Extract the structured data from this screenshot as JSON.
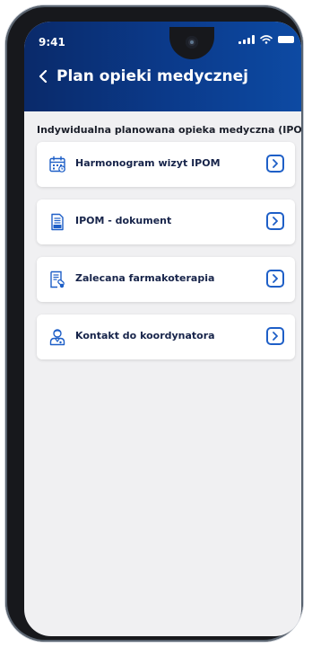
{
  "status_bar": {
    "time": "9:41"
  },
  "header": {
    "title": "Plan opieki medycznej"
  },
  "section": {
    "title": "Indywidualna planowana opieka medyczna (IPOM)"
  },
  "menu": {
    "items": [
      {
        "label": "Harmonogram wizyt IPOM",
        "icon": "calendar-icon"
      },
      {
        "label": "IPOM - dokument",
        "icon": "pdf-document-icon"
      },
      {
        "label": "Zalecana farmakoterapia",
        "icon": "prescription-icon"
      },
      {
        "label": "Kontakt do koordynatora",
        "icon": "doctor-icon"
      }
    ]
  },
  "colors": {
    "header_start": "#0a2a6a",
    "header_end": "#0d4aa3",
    "accent": "#1e5fc7",
    "background": "#f0f0f2",
    "card": "#ffffff"
  }
}
